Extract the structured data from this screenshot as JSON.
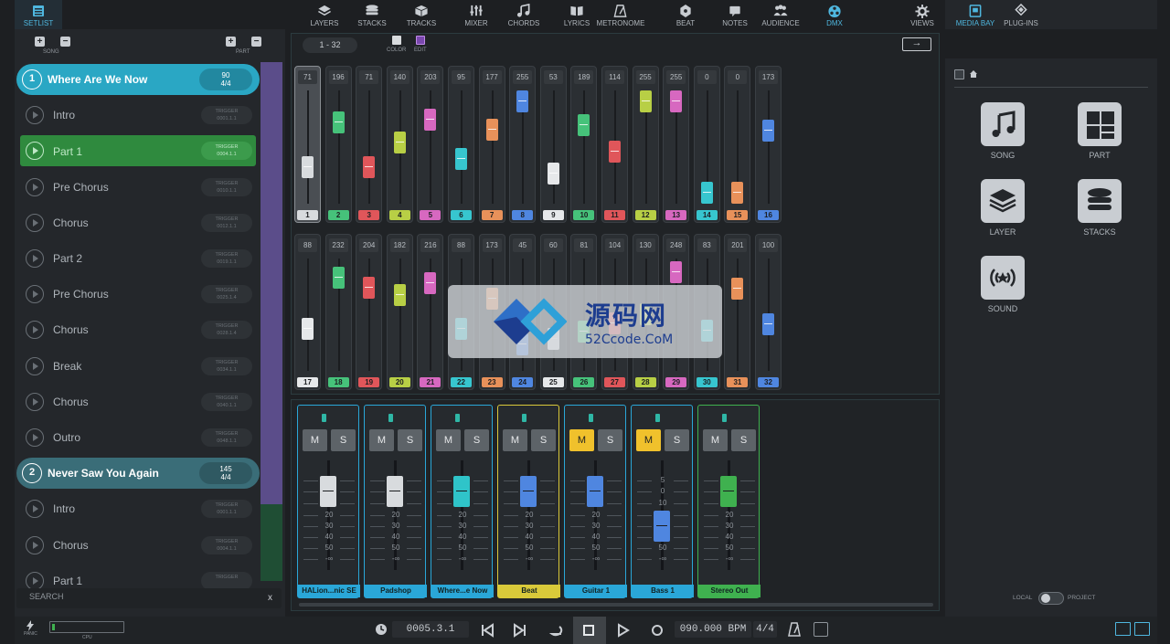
{
  "setlist_tab": {
    "label": "SETLIST"
  },
  "toolbar": [
    {
      "label": "LAYERS",
      "icon": "layers-icon"
    },
    {
      "label": "STACKS",
      "icon": "stacks-icon"
    },
    {
      "label": "TRACKS",
      "icon": "tracks-icon"
    },
    {
      "label": "MIXER",
      "icon": "mixer-icon"
    },
    {
      "label": "CHORDS",
      "icon": "chords-icon"
    },
    {
      "label": "LYRICS",
      "icon": "lyrics-icon"
    },
    {
      "label": "METRONOME",
      "icon": "metronome-icon"
    },
    {
      "label": "BEAT",
      "icon": "beat-icon"
    },
    {
      "label": "NOTES",
      "icon": "notes-icon"
    },
    {
      "label": "AUDIENCE",
      "icon": "audience-icon"
    },
    {
      "label": "DMX",
      "icon": "dmx-icon",
      "active": true
    },
    {
      "label": "VIEWS",
      "icon": "views-icon"
    }
  ],
  "left_panel": {
    "song_label": "SONG",
    "part_label": "PART",
    "search_placeholder": "SEARCH",
    "search_clear": "x"
  },
  "setlist": [
    {
      "type": "song",
      "num": "1",
      "name": "Where Are We Now",
      "bpm": "90",
      "sig": "4/4",
      "color": "#2aa7c4",
      "active": true
    },
    {
      "type": "part",
      "name": "Intro",
      "trigger_label": "TRIGGER",
      "trigger": "0001.1.1"
    },
    {
      "type": "part",
      "name": "Part 1",
      "trigger_label": "TRIGGER",
      "trigger": "0004.1.1",
      "current": true
    },
    {
      "type": "part",
      "name": "Pre Chorus",
      "trigger_label": "TRIGGER",
      "trigger": "0010.1.1"
    },
    {
      "type": "part",
      "name": "Chorus",
      "trigger_label": "TRIGGER",
      "trigger": "0012.1.1"
    },
    {
      "type": "part",
      "name": "Part 2",
      "trigger_label": "TRIGGER",
      "trigger": "0019.1.1"
    },
    {
      "type": "part",
      "name": "Pre Chorus",
      "trigger_label": "TRIGGER",
      "trigger": "0025.1.4"
    },
    {
      "type": "part",
      "name": "Chorus",
      "trigger_label": "TRIGGER",
      "trigger": "0028.1.4"
    },
    {
      "type": "part",
      "name": "Break",
      "trigger_label": "TRIGGER",
      "trigger": "0034.1.1"
    },
    {
      "type": "part",
      "name": "Chorus",
      "trigger_label": "TRIGGER",
      "trigger": "0040.1.1"
    },
    {
      "type": "part",
      "name": "Outro",
      "trigger_label": "TRIGGER",
      "trigger": "0048.1.1"
    },
    {
      "type": "song",
      "num": "2",
      "name": "Never Saw You Again",
      "bpm": "145",
      "sig": "4/4",
      "color": "#3a6d78"
    },
    {
      "type": "part",
      "name": "Intro",
      "trigger_label": "TRIGGER",
      "trigger": "0001.1.1"
    },
    {
      "type": "part",
      "name": "Chorus",
      "trigger_label": "TRIGGER",
      "trigger": "0004.1.1"
    },
    {
      "type": "part",
      "name": "Part 1",
      "trigger_label": "TRIGGER",
      "trigger": ""
    }
  ],
  "dmx": {
    "range": "1 - 32",
    "color_label": "COLOR",
    "edit_label": "EDIT",
    "arrow": "→",
    "channels": [
      {
        "num": "1",
        "value": "71",
        "color": "#d8dbde",
        "selected": true
      },
      {
        "num": "2",
        "value": "196",
        "color": "#46c27a"
      },
      {
        "num": "3",
        "value": "71",
        "color": "#e0565a"
      },
      {
        "num": "4",
        "value": "140",
        "color": "#b8cf45"
      },
      {
        "num": "5",
        "value": "203",
        "color": "#d768c0"
      },
      {
        "num": "6",
        "value": "95",
        "color": "#37c6cf"
      },
      {
        "num": "7",
        "value": "177",
        "color": "#e8915a"
      },
      {
        "num": "8",
        "value": "255",
        "color": "#4f86e0"
      },
      {
        "num": "9",
        "value": "53",
        "color": "#e6e8ea"
      },
      {
        "num": "10",
        "value": "189",
        "color": "#46c27a"
      },
      {
        "num": "11",
        "value": "114",
        "color": "#e0565a"
      },
      {
        "num": "12",
        "value": "255",
        "color": "#b8cf45"
      },
      {
        "num": "13",
        "value": "255",
        "color": "#d768c0"
      },
      {
        "num": "14",
        "value": "0",
        "color": "#37c6cf"
      },
      {
        "num": "15",
        "value": "0",
        "color": "#e8915a"
      },
      {
        "num": "16",
        "value": "173",
        "color": "#4f86e0"
      },
      {
        "num": "17",
        "value": "88",
        "color": "#e6e8ea"
      },
      {
        "num": "18",
        "value": "232",
        "color": "#46c27a"
      },
      {
        "num": "19",
        "value": "204",
        "color": "#e0565a"
      },
      {
        "num": "20",
        "value": "182",
        "color": "#b8cf45"
      },
      {
        "num": "21",
        "value": "216",
        "color": "#d768c0"
      },
      {
        "num": "22",
        "value": "88",
        "color": "#37c6cf"
      },
      {
        "num": "23",
        "value": "173",
        "color": "#e8915a"
      },
      {
        "num": "24",
        "value": "45",
        "color": "#4f86e0"
      },
      {
        "num": "25",
        "value": "60",
        "color": "#e6e8ea"
      },
      {
        "num": "26",
        "value": "81",
        "color": "#46c27a"
      },
      {
        "num": "27",
        "value": "104",
        "color": "#e0565a"
      },
      {
        "num": "28",
        "value": "130",
        "color": "#b8cf45"
      },
      {
        "num": "29",
        "value": "248",
        "color": "#d768c0"
      },
      {
        "num": "30",
        "value": "83",
        "color": "#37c6cf"
      },
      {
        "num": "31",
        "value": "201",
        "color": "#e8915a"
      },
      {
        "num": "32",
        "value": "100",
        "color": "#4f86e0"
      }
    ]
  },
  "mixer": {
    "scale": [
      "5",
      "0",
      "10",
      "20",
      "30",
      "40",
      "50",
      "-∞"
    ],
    "strips": [
      {
        "name": "HALion...nic SE",
        "color": "#2aa7d8",
        "mute_label": "M",
        "solo_label": "S",
        "muted": false,
        "fader_color": "#d8dbde",
        "level_db": 0
      },
      {
        "name": "Padshop",
        "color": "#2aa7d8",
        "mute_label": "M",
        "solo_label": "S",
        "muted": false,
        "fader_color": "#d8dbde",
        "level_db": 0
      },
      {
        "name": "Where...e Now",
        "color": "#2aa7d8",
        "mute_label": "M",
        "solo_label": "S",
        "muted": false,
        "fader_color": "#2fc4c9",
        "level_db": 0
      },
      {
        "name": "Beat",
        "color": "#d9c93a",
        "mute_label": "M",
        "solo_label": "S",
        "muted": false,
        "fader_color": "#4f86e0",
        "level_db": 0
      },
      {
        "name": "Guitar 1",
        "color": "#2aa7d8",
        "mute_label": "M",
        "solo_label": "S",
        "muted": true,
        "fader_color": "#4f86e0",
        "level_db": 0
      },
      {
        "name": "Bass 1",
        "color": "#2aa7d8",
        "mute_label": "M",
        "solo_label": "S",
        "muted": true,
        "fader_color": "#4f86e0",
        "level_db": -30
      },
      {
        "name": "Stereo Out",
        "color": "#3fb14f",
        "mute_label": "M",
        "solo_label": "S",
        "muted": false,
        "fader_color": "#3fb14f",
        "level_db": 0
      }
    ]
  },
  "right_panel": {
    "tabs": [
      {
        "label": "MEDIA BAY",
        "icon": "media-bay-icon",
        "active": true
      },
      {
        "label": "PLUG-INS",
        "icon": "plugins-icon"
      }
    ],
    "tiles": [
      {
        "label": "SONG",
        "icon": "song-icon"
      },
      {
        "label": "PART",
        "icon": "part-icon"
      },
      {
        "label": "LAYER",
        "icon": "layer-icon"
      },
      {
        "label": "STACKS",
        "icon": "stacks-icon"
      },
      {
        "label": "SOUND",
        "icon": "sound-icon"
      }
    ],
    "toggle_left": "LOCAL",
    "toggle_right": "PROJECT"
  },
  "transport": {
    "panic_label": "PANIC",
    "cpu_label": "CPU",
    "position": "0005.3.1",
    "bpm": "090.000 BPM",
    "signature": "4/4"
  },
  "watermark": {
    "title": "源码网",
    "url": "52Ccode.CoM"
  }
}
